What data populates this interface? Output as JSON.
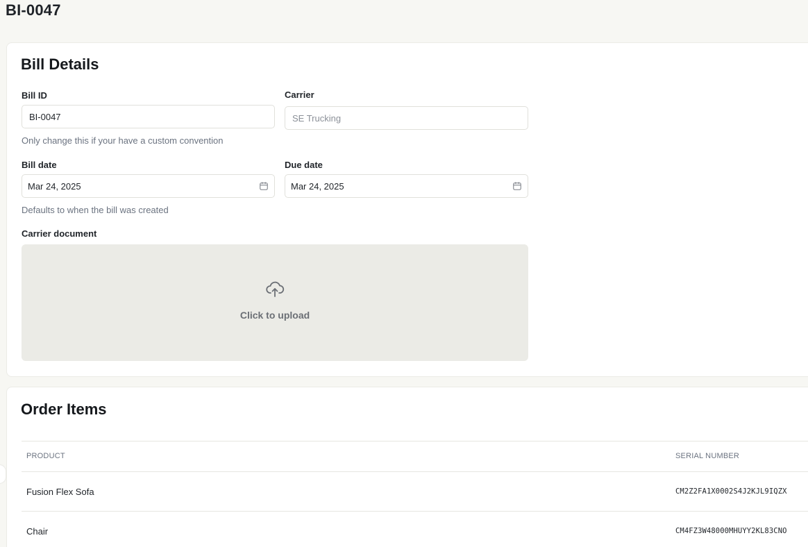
{
  "page": {
    "title": "BI-0047"
  },
  "bill_details": {
    "title": "Bill Details",
    "bill_id": {
      "label": "Bill ID",
      "value": "BI-0047",
      "helper": "Only change this if your have a custom convention"
    },
    "carrier": {
      "label": "Carrier",
      "placeholder": "SE Trucking"
    },
    "bill_date": {
      "label": "Bill date",
      "value": "Mar 24, 2025",
      "helper": "Defaults to when the bill was created"
    },
    "due_date": {
      "label": "Due date",
      "value": "Mar 24, 2025"
    },
    "carrier_document": {
      "label": "Carrier document",
      "upload_text": "Click to upload"
    }
  },
  "order_items": {
    "title": "Order Items",
    "columns": {
      "product": "PRODUCT",
      "serial": "SERIAL NUMBER"
    },
    "rows": [
      {
        "product": "Fusion Flex Sofa",
        "serial": "CM2Z2FA1X0002S4J2KJL9IQZX"
      },
      {
        "product": "Chair",
        "serial": "CM4FZ3W48000MHUYY2KL83CNO"
      }
    ]
  },
  "colors": {
    "page_bg": "#f7f7f3",
    "card_bg": "#ffffff",
    "upload_bg": "#ebebe6",
    "helper_text": "#6b7380"
  },
  "icons": [
    "calendar-icon",
    "upload-cloud-icon"
  ]
}
